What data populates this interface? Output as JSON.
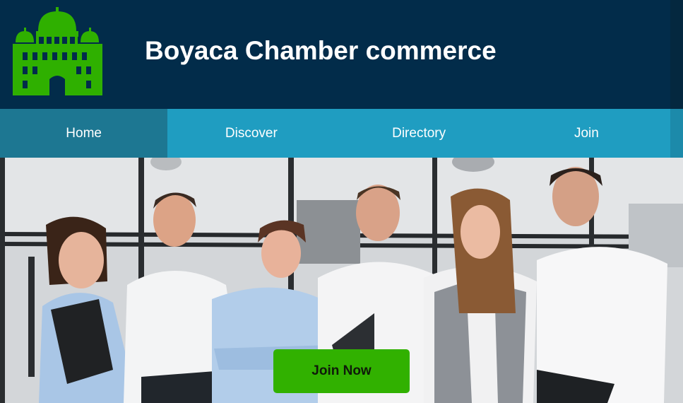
{
  "header": {
    "title": "Boyaca Chamber commerce",
    "logo_icon": "building-dome-icon",
    "background": "#022c4a"
  },
  "nav": {
    "items": [
      {
        "label": "Home",
        "active": true
      },
      {
        "label": "Discover",
        "active": false
      },
      {
        "label": "Directory",
        "active": false
      },
      {
        "label": "Join",
        "active": false
      }
    ],
    "background": "#1f9dc1",
    "active_background": "#1d7792"
  },
  "hero": {
    "image": "group-of-business-people-photo",
    "cta_label": "Join Now",
    "cta_color": "#31b100"
  }
}
